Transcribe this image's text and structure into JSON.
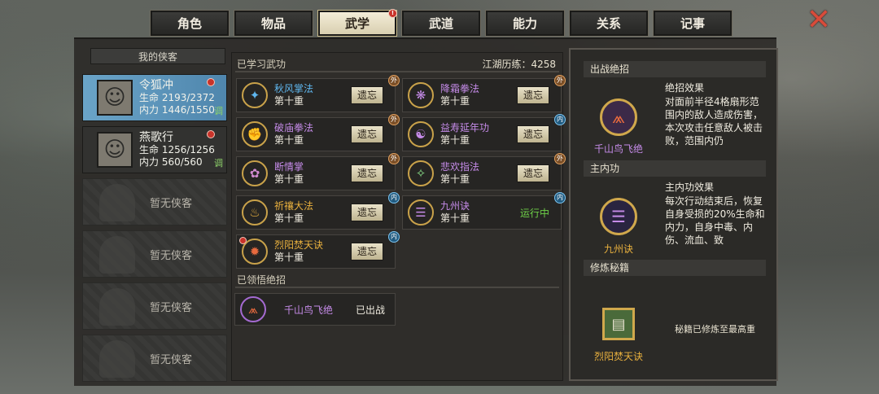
{
  "tabs": [
    {
      "label": "角色"
    },
    {
      "label": "物品"
    },
    {
      "label": "武学"
    },
    {
      "label": "武道"
    },
    {
      "label": "能力"
    },
    {
      "label": "关系"
    },
    {
      "label": "记事"
    }
  ],
  "active_tab": "武学",
  "close_icon": "close-x-icon",
  "heroes": {
    "header": "我的侠客",
    "list": [
      {
        "name": "令狐冲",
        "hp": "生命 2193/2372",
        "mp": "内力 1446/1550",
        "tune": "调"
      },
      {
        "name": "燕歌行",
        "hp": "生命 1256/1256",
        "mp": "内力 560/560",
        "tune": "调"
      }
    ],
    "empty_label": "暂无侠客"
  },
  "learned": {
    "title": "已学习武功",
    "jianghu": "江湖历练：4258",
    "forget_label": "遗忘",
    "running_label": "运行中",
    "skills": [
      {
        "name": "秋风掌法",
        "level": "第十重",
        "tag": "外",
        "color": "blue"
      },
      {
        "name": "降霜拳法",
        "level": "第十重",
        "tag": "外",
        "color": "purple"
      },
      {
        "name": "破庙拳法",
        "level": "第十重",
        "tag": "外",
        "color": "purple"
      },
      {
        "name": "益寿延年功",
        "level": "第十重",
        "tag": "内",
        "color": "purple"
      },
      {
        "name": "断情掌",
        "level": "第十重",
        "tag": "外",
        "color": "purple"
      },
      {
        "name": "悲欢指法",
        "level": "第十重",
        "tag": "外",
        "color": "purple"
      },
      {
        "name": "祈禳大法",
        "level": "第十重",
        "tag": "内",
        "color": "gold"
      },
      {
        "name": "九州诀",
        "level": "第十重",
        "tag": "内",
        "color": "purple"
      },
      {
        "name": "烈阳焚天诀",
        "level": "第十重",
        "tag": "内",
        "color": "gold"
      }
    ]
  },
  "ultimate": {
    "title": "已领悟绝招",
    "name": "千山鸟飞绝",
    "state": "已出战"
  },
  "right": {
    "battle_head": "出战绝招",
    "battle_name": "千山鸟飞绝",
    "effect_title": "绝招效果",
    "effect_desc": "对面前半径4格扇形范围内的敌人造成伤害，本次攻击任意敌人被击败，范围内仍",
    "inner_head": "主内功",
    "inner_name": "九州诀",
    "inner_title": "主内功效果",
    "inner_desc": "每次行动结束后，恢复自身受损的20%生命和内力，自身中毒、内伤、流血、致",
    "book_head": "修炼秘籍",
    "book_name": "烈阳焚天诀",
    "book_note": "秘籍已修炼至最高重"
  }
}
